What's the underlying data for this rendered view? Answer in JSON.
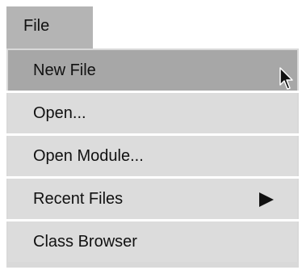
{
  "menubar": {
    "file_label": "File"
  },
  "menu": {
    "items": [
      {
        "label": "New File",
        "highlighted": true
      },
      {
        "label": "Open..."
      },
      {
        "label": "Open Module..."
      },
      {
        "label": "Recent Files",
        "submenu_icon": "submenu-arrow-icon"
      },
      {
        "label": "Class Browser"
      }
    ]
  },
  "cursor": {
    "icon": "mouse-pointer-icon"
  },
  "colors": {
    "menubar_active": "#b4b4b4",
    "menu_background": "#dcdcdc",
    "menu_item_highlight": "#a7a7a7",
    "separator": "#ffffff",
    "text": "#111111"
  }
}
